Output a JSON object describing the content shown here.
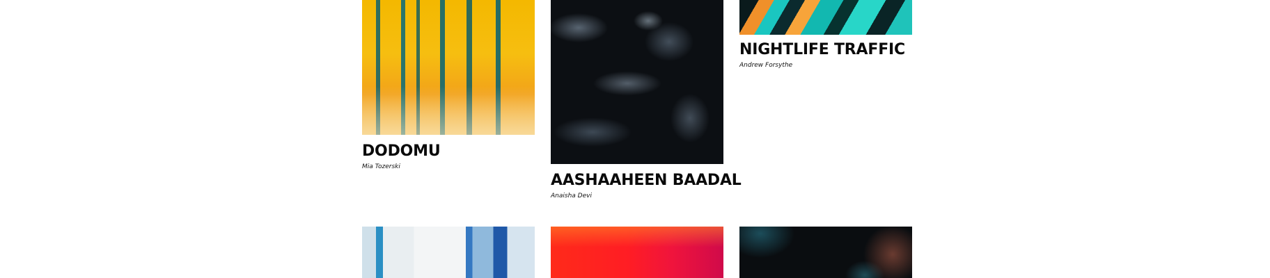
{
  "gallery": {
    "items": [
      {
        "title": "DODOMU",
        "artist": "Mia Tozerski"
      },
      {
        "title": "AASHAAHEEN BAADAL",
        "artist": "Anaisha Devi"
      },
      {
        "title": "NIGHTLIFE TRAFFIC",
        "artist": "Andrew Forsythe"
      }
    ],
    "artworks": [
      {
        "palette": [
          "#f4b800",
          "#0e606c"
        ]
      },
      {
        "palette": [
          "#0c0f13",
          "#9ab0c4"
        ]
      },
      {
        "palette": [
          "#1ac6c0",
          "#f0902a"
        ]
      },
      {
        "palette": [
          "#f3f5f6",
          "#2a8fc4"
        ]
      },
      {
        "palette": [
          "#ff2a1a",
          "#d00a4a"
        ]
      },
      {
        "palette": [
          "#0a0d10",
          "#2878a0"
        ]
      }
    ]
  }
}
